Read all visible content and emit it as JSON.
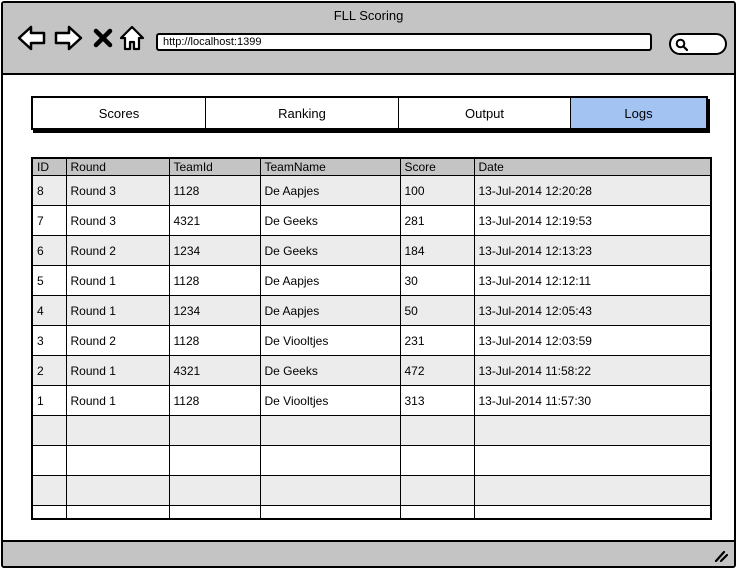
{
  "window": {
    "title": "FLL Scoring"
  },
  "browser": {
    "url": "http://localhost:1399",
    "icons": {
      "back": "back-arrow-icon",
      "forward": "forward-arrow-icon",
      "stop": "close-icon",
      "home": "home-icon",
      "search": "search-icon",
      "resize": "resize-grip-icon"
    }
  },
  "tabs": [
    {
      "label": "Scores",
      "active": false
    },
    {
      "label": "Ranking",
      "active": false
    },
    {
      "label": "Output",
      "active": false
    },
    {
      "label": "Logs",
      "active": true
    }
  ],
  "colors": {
    "active_tab": "#a3c4f3",
    "chrome": "#c4c4c4",
    "stripe": "#ececec"
  },
  "logs": {
    "columns": [
      "ID",
      "Round",
      "TeamId",
      "TeamName",
      "Score",
      "Date"
    ],
    "rows": [
      [
        "8",
        "Round 3",
        "1128",
        "De Aapjes",
        "100",
        "13-Jul-2014 12:20:28"
      ],
      [
        "7",
        "Round 3",
        "4321",
        "De Geeks",
        "281",
        "13-Jul-2014 12:19:53"
      ],
      [
        "6",
        "Round 2",
        "1234",
        "De Geeks",
        "184",
        "13-Jul-2014 12:13:23"
      ],
      [
        "5",
        "Round 1",
        "1128",
        "De Aapjes",
        "30",
        "13-Jul-2014 12:12:11"
      ],
      [
        "4",
        "Round 1",
        "1234",
        "De Aapjes",
        "50",
        "13-Jul-2014 12:05:43"
      ],
      [
        "3",
        "Round 2",
        "1128",
        "De Viooltjes",
        "231",
        "13-Jul-2014 12:03:59"
      ],
      [
        "2",
        "Round 1",
        "4321",
        "De Geeks",
        "472",
        "13-Jul-2014 11:58:22"
      ],
      [
        "1",
        "Round 1",
        "1128",
        "De Viooltjes",
        "313",
        "13-Jul-2014 11:57:30"
      ],
      [
        "",
        "",
        "",
        "",
        "",
        ""
      ],
      [
        "",
        "",
        "",
        "",
        "",
        ""
      ],
      [
        "",
        "",
        "",
        "",
        "",
        ""
      ],
      [
        "",
        "",
        "",
        "",
        "",
        ""
      ]
    ]
  }
}
